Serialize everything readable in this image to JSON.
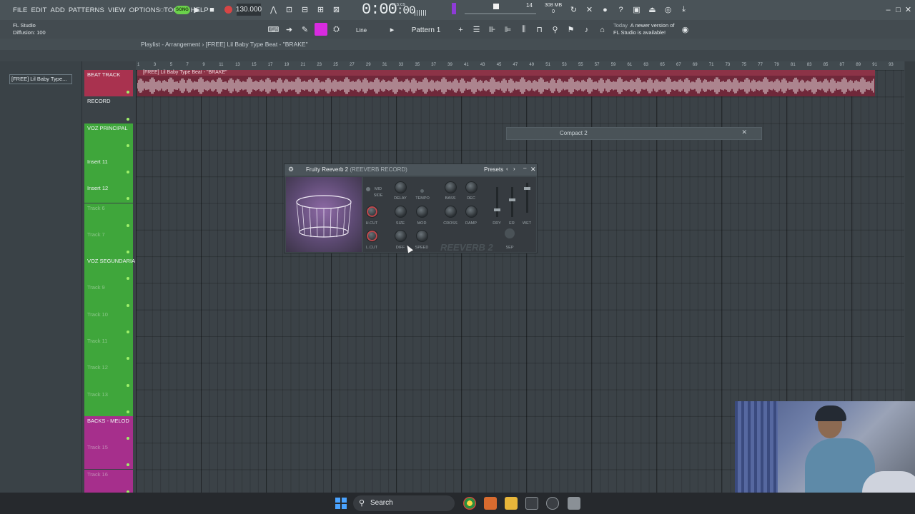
{
  "app": {
    "menu": [
      "FILE",
      "EDIT",
      "ADD",
      "PATTERNS",
      "VIEW",
      "OPTIONS",
      "TOOLS",
      "HELP"
    ],
    "song_mode": "SONG",
    "tempo": "130.000",
    "time": "0:00",
    "time_frac": ":00",
    "time_unit": "M:S:CS",
    "cpu": "14",
    "memory": "308 MB",
    "memory_sub": "0"
  },
  "hint": {
    "line1": "FL Studio",
    "line2": "Diffusion: 100"
  },
  "toolbar2": {
    "snap": "Line",
    "pattern": "Pattern 1",
    "news_label": "Today",
    "news_text_1": "A newer version of",
    "news_text_2": "FL Studio is available!"
  },
  "playlist": {
    "title": "Playlist - Arrangement",
    "song_name": "[FREE] Lil Baby Type Beat - \"BRAKE\"",
    "browser_item": "[FREE] Lil Baby Type...",
    "clip_label": "[FREE] Lil Baby Type Beat - \"BRAKE\"",
    "ruler": [
      "1",
      "3",
      "5",
      "7",
      "9",
      "11",
      "13",
      "15",
      "17",
      "19",
      "21",
      "23",
      "25",
      "27",
      "29",
      "31",
      "33",
      "35",
      "37",
      "39",
      "41",
      "43",
      "45",
      "47",
      "49",
      "51",
      "53",
      "55",
      "57",
      "59",
      "61",
      "63",
      "65",
      "67",
      "69",
      "71",
      "73",
      "75",
      "77",
      "79",
      "81",
      "83",
      "85",
      "87",
      "89",
      "91",
      "93"
    ],
    "tracks": [
      {
        "name": "BEAT TRACK",
        "color": "#a9324f"
      },
      {
        "name": "RECORD",
        "color": "#3b4247"
      },
      {
        "name": "VOZ PRINCIPAL",
        "color": "#3fa63b"
      },
      {
        "name": "Insert 11",
        "color": "#3fa63b"
      },
      {
        "name": "Insert 12",
        "color": "#3fa63b"
      },
      {
        "name": "Track 6",
        "color": "#3fa63b"
      },
      {
        "name": "Track 7",
        "color": "#3fa63b"
      },
      {
        "name": "VOZ SEGUNDARIA",
        "color": "#3fa63b"
      },
      {
        "name": "Track 9",
        "color": "#3fa63b"
      },
      {
        "name": "Track 10",
        "color": "#3fa63b"
      },
      {
        "name": "Track 11",
        "color": "#3fa63b"
      },
      {
        "name": "Track 12",
        "color": "#3fa63b"
      },
      {
        "name": "Track 13",
        "color": "#3fa63b"
      },
      {
        "name": "BACKS - MELOD",
        "color": "#a62f8c"
      },
      {
        "name": "Track 15",
        "color": "#a62f8c"
      },
      {
        "name": "Track 16",
        "color": "#a62f8c"
      }
    ]
  },
  "compact": {
    "label": "Compact 2"
  },
  "reverb": {
    "plugin": "Fruity Reeverb 2",
    "target": "(REEVERB RECORD)",
    "presets": "Presets",
    "labels": {
      "mid": "MID",
      "side": "SIDE",
      "delay": "DELAY",
      "tempo": "TEMPO",
      "bass": "BASS",
      "dec": "DEC",
      "hcut": "H.CUT",
      "size": "SIZE",
      "mod": "MOD",
      "cross": "CROSS",
      "damp": "DAMP",
      "dry": "DRY",
      "er": "ER",
      "wet": "WET",
      "lcut": "L.CUT",
      "diff": "DIFF",
      "speed": "SPEED",
      "sep": "SEP"
    },
    "logo": "REEVERB 2"
  },
  "taskbar": {
    "search": "Search"
  }
}
